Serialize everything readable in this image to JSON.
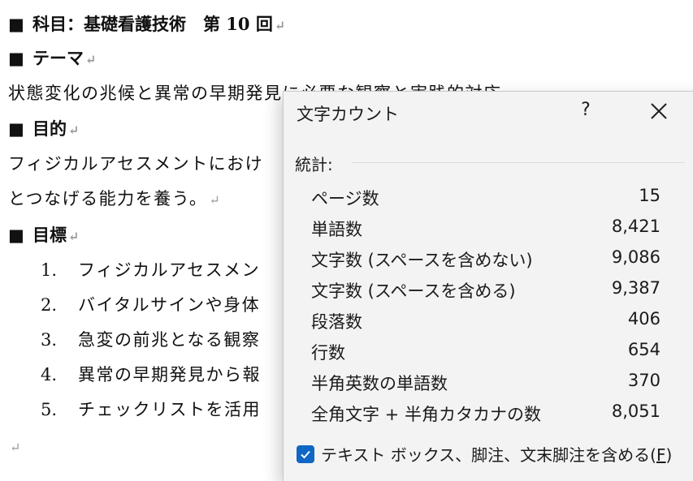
{
  "document": {
    "heading_subject": "科目：基礎看護技術　第 10 回",
    "heading_theme": "テーマ",
    "theme_text": "状態変化の兆候と異常の早期発見に必要な観察と実践的対応",
    "heading_purpose": "目的",
    "purpose_line1": "フィジカルアセスメントにおけ",
    "purpose_line2": "とつなげる能力を養う。",
    "heading_goals": "目標",
    "goals": [
      {
        "num": "1.",
        "text": "フィジカルアセスメン"
      },
      {
        "num": "2.",
        "text": "バイタルサインや身体"
      },
      {
        "num": "3.",
        "text": "急変の前兆となる観察"
      },
      {
        "num": "4.",
        "text": "異常の早期発見から報"
      },
      {
        "num": "5.",
        "text": "チェックリストを活用"
      }
    ],
    "square_bullet": "■",
    "return_mark": "↵"
  },
  "dialog": {
    "title": "文字カウント",
    "help_label": "?",
    "statistics_label": "統計:",
    "stats": [
      {
        "label": "ページ数",
        "value": "15"
      },
      {
        "label": "単語数",
        "value": "8,421"
      },
      {
        "label": "文字数 (スペースを含めない)",
        "value": "9,086"
      },
      {
        "label": "文字数 (スペースを含める)",
        "value": "9,387"
      },
      {
        "label": "段落数",
        "value": "406"
      },
      {
        "label": "行数",
        "value": "654"
      },
      {
        "label": "半角英数の単語数",
        "value": "370"
      },
      {
        "label": "全角文字 + 半角カタカナの数",
        "value": "8,051"
      }
    ],
    "checkbox_label_main": "テキスト ボックス、脚注、文末脚注を含める(",
    "checkbox_label_key": "F",
    "checkbox_label_end": ")",
    "checkbox_checked": true,
    "accent_color": "#0f66c4"
  }
}
